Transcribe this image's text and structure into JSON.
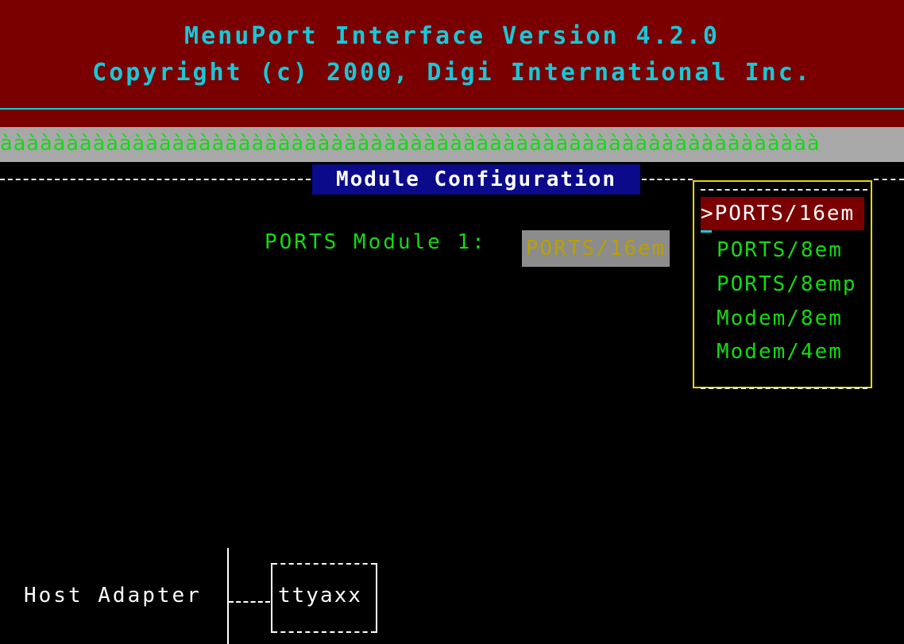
{
  "header": {
    "title": "MenuPort Interface Version 4.2.0",
    "copyright": "Copyright (c) 2000, Digi International Inc."
  },
  "band": {
    "text": "àààààààààààààààààààààààààààààààààààààààààààààààààààààààààààààà"
  },
  "module_config": {
    "title": "Module Configuration",
    "field_label": "PORTS Module 1:",
    "field_value": "PORTS/16em"
  },
  "popup": {
    "selected_marker": ">",
    "options": [
      "PORTS/16em",
      "PORTS/8em",
      "PORTS/8emp",
      "Modem/8em",
      "Modem/4em"
    ]
  },
  "tree": {
    "host_label": "Host Adapter",
    "tty_label": "ttyaxx"
  },
  "colors": {
    "header_bg": "#7a0000",
    "header_text": "#18c8d8",
    "green_text": "#16d816",
    "title_bg": "#0a0a8a",
    "popup_border": "#e8d800"
  }
}
